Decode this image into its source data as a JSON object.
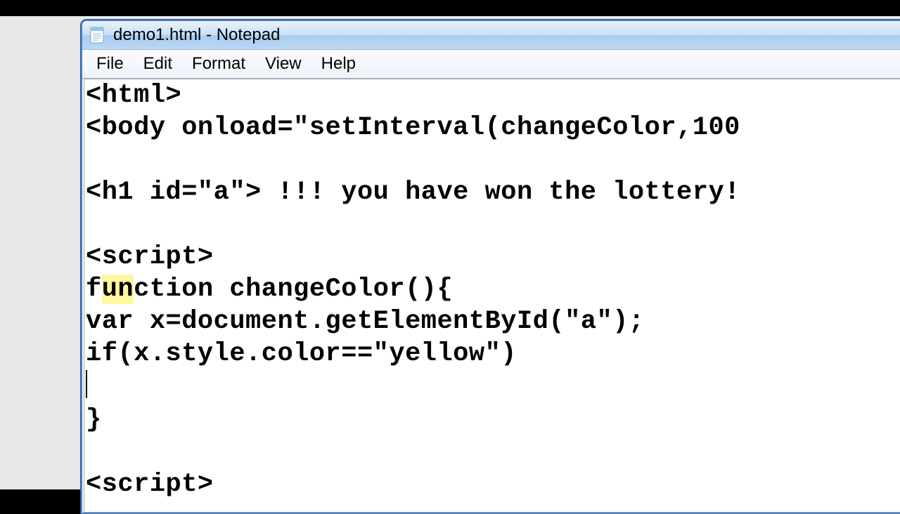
{
  "window": {
    "title": "demo1.html - Notepad"
  },
  "menu": {
    "file": "File",
    "edit": "Edit",
    "format": "Format",
    "view": "View",
    "help": "Help"
  },
  "code": {
    "l1": "<html>",
    "l2": "<body onload=\"setInterval(changeColor,100",
    "l3": "",
    "l4": "<h1 id=\"a\"> !!! you have won the lottery!",
    "l5": "",
    "l6": "<script>",
    "l7a": "f",
    "l7b": "un",
    "l7c": "ction changeColor(){",
    "l8": "var x=document.getElementById(\"a\");",
    "l9": "if(x.style.color==\"yellow\")",
    "l10": "",
    "l11": "}",
    "l12": "",
    "l13": "<script>"
  }
}
